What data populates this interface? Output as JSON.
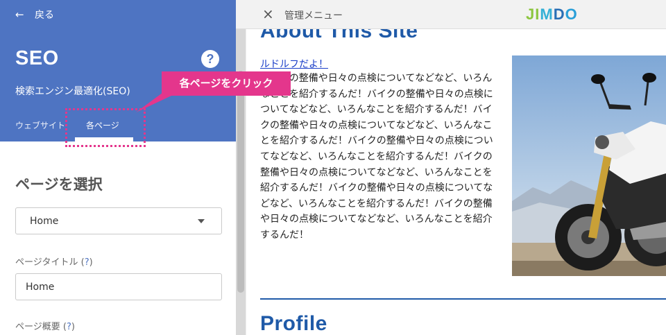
{
  "left_panel": {
    "back_label": "戻る",
    "title": "SEO",
    "help_icon": "?",
    "subtitle": "検索エンジン最適化(SEO)",
    "tabs": [
      {
        "label": "ウェブサイト",
        "active": false
      },
      {
        "label": "各ページ",
        "active": true
      }
    ],
    "section_title": "ページを選択",
    "page_select": {
      "value": "Home"
    },
    "page_title_field": {
      "label": "ページタイトル (",
      "help": "?",
      "close": ")",
      "value": "Home"
    },
    "page_summary_field": {
      "label": "ページ概要 (",
      "help": "?",
      "close": ")"
    }
  },
  "right_panel": {
    "close_icon": "×",
    "menu_title": "管理メニュー",
    "logo": {
      "j": "J",
      "i": "I",
      "m": "M",
      "d": "D",
      "o": "O"
    },
    "site": {
      "heading": "About This Site",
      "link": "ルドルフだよ！",
      "body": "バイクの整備や日々の点検についてなどなど、いろんなことを紹介するんだ！バイクの整備や日々の点検についてなどなど、いろんなことを紹介するんだ！バイクの整備や日々の点検についてなどなど、いろんなことを紹介するんだ！バイクの整備や日々の点検についてなどなど、いろんなことを紹介するんだ！バイクの整備や日々の点検についてなどなど、いろんなことを紹介するんだ！バイクの整備や日々の点検についてなどなど、いろんなことを紹介するんだ！バイクの整備や日々の点検についてなどなど、いろんなことを紹介するんだ！",
      "heading2": "Profile"
    }
  },
  "annotation": {
    "callout": "各ページをクリック",
    "color": "#e4368c"
  },
  "colors": {
    "brand_blue": "#4e74c2",
    "heading_blue": "#1f5aa8",
    "link_blue": "#1a3ec8"
  }
}
